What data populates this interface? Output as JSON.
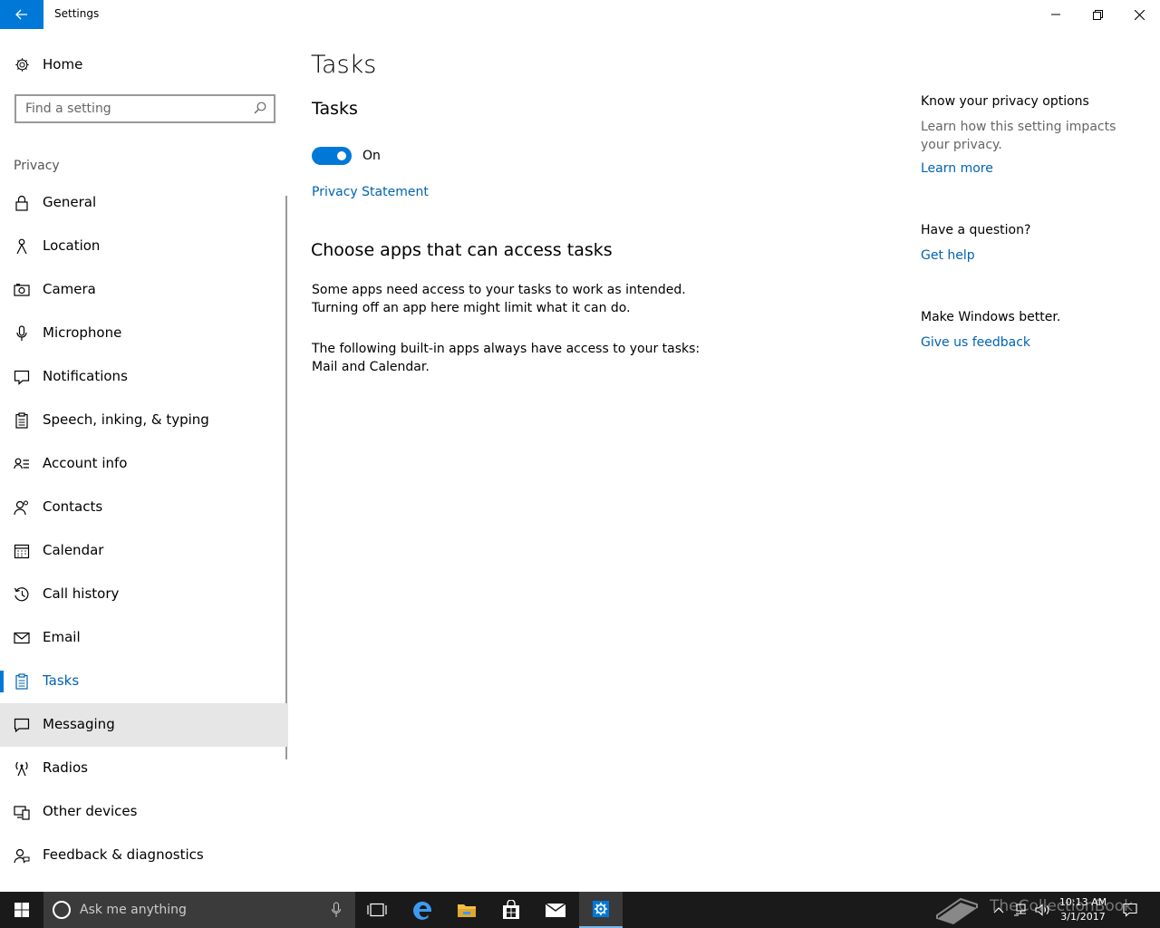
{
  "window": {
    "title": "Settings",
    "controls": {
      "minimize": "minimize-icon",
      "restore": "restore-icon",
      "close": "close-icon"
    }
  },
  "sidebar": {
    "home_label": "Home",
    "search_placeholder": "Find a setting",
    "section": "Privacy",
    "items": [
      {
        "label": "General",
        "icon": "lock-icon"
      },
      {
        "label": "Location",
        "icon": "location-icon"
      },
      {
        "label": "Camera",
        "icon": "camera-icon"
      },
      {
        "label": "Microphone",
        "icon": "microphone-icon"
      },
      {
        "label": "Notifications",
        "icon": "notifications-icon"
      },
      {
        "label": "Speech, inking, & typing",
        "icon": "clipboard-icon"
      },
      {
        "label": "Account info",
        "icon": "account-info-icon"
      },
      {
        "label": "Contacts",
        "icon": "contacts-icon"
      },
      {
        "label": "Calendar",
        "icon": "calendar-icon"
      },
      {
        "label": "Call history",
        "icon": "history-icon"
      },
      {
        "label": "Email",
        "icon": "mail-icon"
      },
      {
        "label": "Tasks",
        "icon": "tasks-icon"
      },
      {
        "label": "Messaging",
        "icon": "message-icon"
      },
      {
        "label": "Radios",
        "icon": "radio-tower-icon"
      },
      {
        "label": "Other devices",
        "icon": "devices-icon"
      },
      {
        "label": "Feedback & diagnostics",
        "icon": "feedback-icon"
      }
    ],
    "selected": "Tasks",
    "hovered": "Messaging"
  },
  "main": {
    "title": "Tasks",
    "subtitle": "Tasks",
    "toggle_state": "On",
    "privacy_link": "Privacy Statement",
    "choose_heading": "Choose apps that can access tasks",
    "para1": "Some apps need access to your tasks to work as intended. Turning off an app here might limit what it can do.",
    "para2": "The following built-in apps always have access to your tasks: Mail and Calendar."
  },
  "right": {
    "privacy_heading": "Know your privacy options",
    "privacy_text": "Learn how this setting impacts your privacy.",
    "learn_more": "Learn more",
    "question_heading": "Have a question?",
    "get_help": "Get help",
    "better_heading": "Make Windows better.",
    "feedback_link": "Give us feedback"
  },
  "taskbar": {
    "search_placeholder": "Ask me anything",
    "time": "10:13 AM",
    "date": "3/1/2017",
    "watermark": "TheCollectionBook",
    "accent": "#0078d7"
  }
}
